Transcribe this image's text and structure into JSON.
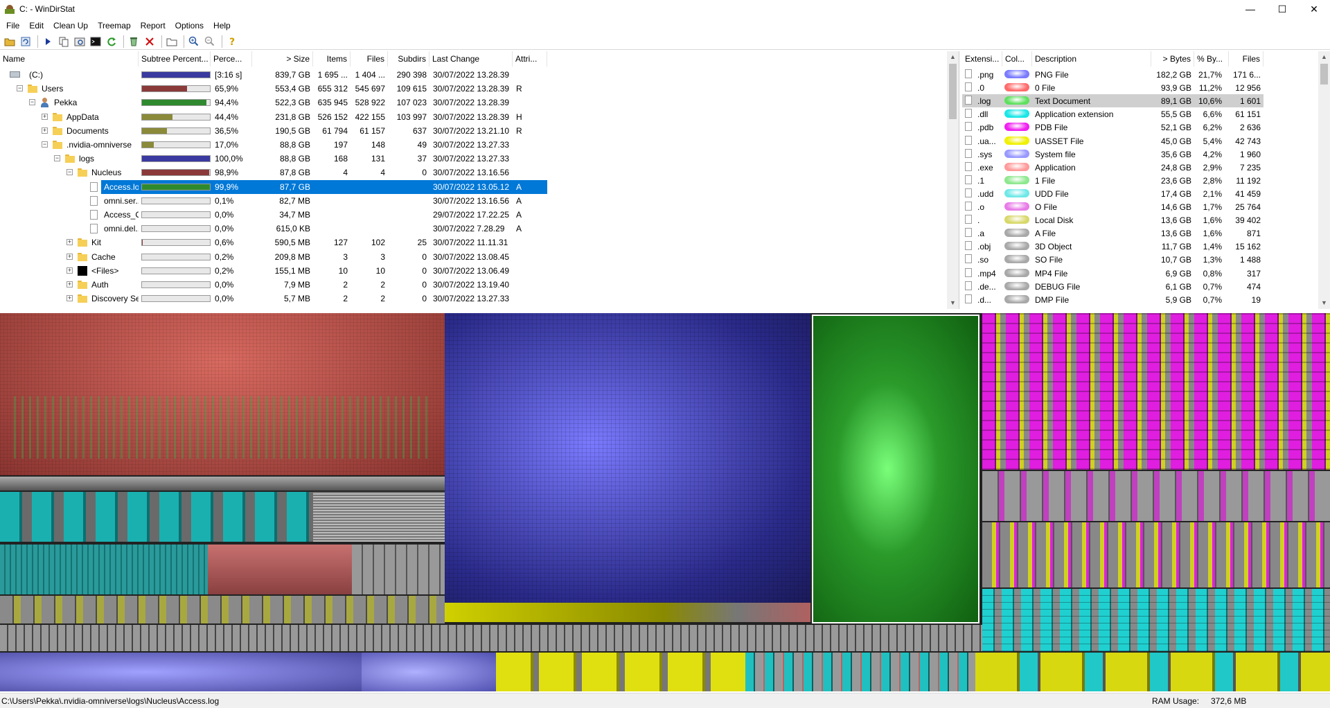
{
  "window": {
    "title": "C: - WinDirStat",
    "min": "—",
    "max": "☐",
    "close": "✕"
  },
  "menu": [
    "File",
    "Edit",
    "Clean Up",
    "Treemap",
    "Report",
    "Options",
    "Help"
  ],
  "toolbar_icons": [
    "open-icon",
    "refresh-all-icon",
    "play-icon",
    "copy-path-icon",
    "explorer-icon",
    "command-prompt-icon",
    "refresh-icon",
    "recycle-icon",
    "delete-icon",
    "new-folder-icon",
    "zoom-in-icon",
    "zoom-out-icon",
    "help-icon"
  ],
  "tree": {
    "columns": [
      "Name",
      "Subtree Percent...",
      "Perce...",
      "> Size",
      "Items",
      "Files",
      "Subdirs",
      "Last Change",
      "Attri..."
    ],
    "rows": [
      {
        "name": "(C:)",
        "icon": "drive",
        "indent": 0,
        "exp": "",
        "bar": 1.0,
        "bar_color": "#3a3aa0",
        "pct": "[3:16 s]",
        "size": "839,7 GB",
        "items": "1 695 ...",
        "files": "1 404 ...",
        "subdirs": "290 398",
        "changed": "30/07/2022  13.28.39",
        "attr": ""
      },
      {
        "name": "Users",
        "icon": "folder",
        "indent": 1,
        "exp": "−",
        "bar": 0.659,
        "bar_color": "#8b3a3a",
        "pct": "65,9%",
        "size": "553,4 GB",
        "items": "655 312",
        "files": "545 697",
        "subdirs": "109 615",
        "changed": "30/07/2022  13.28.39",
        "attr": "R"
      },
      {
        "name": "Pekka",
        "icon": "user",
        "indent": 2,
        "exp": "−",
        "bar": 0.944,
        "bar_color": "#2f8a2f",
        "pct": "94,4%",
        "size": "522,3 GB",
        "items": "635 945",
        "files": "528 922",
        "subdirs": "107 023",
        "changed": "30/07/2022  13.28.39",
        "attr": ""
      },
      {
        "name": "AppData",
        "icon": "folder",
        "indent": 3,
        "exp": "+",
        "bar": 0.444,
        "bar_color": "#8a8a3a",
        "pct": "44,4%",
        "size": "231,8 GB",
        "items": "526 152",
        "files": "422 155",
        "subdirs": "103 997",
        "changed": "30/07/2022  13.28.39",
        "attr": "H"
      },
      {
        "name": "Documents",
        "icon": "docs",
        "indent": 3,
        "exp": "+",
        "bar": 0.365,
        "bar_color": "#8a8a3a",
        "pct": "36,5%",
        "size": "190,5 GB",
        "items": "61 794",
        "files": "61 157",
        "subdirs": "637",
        "changed": "30/07/2022  13.21.10",
        "attr": "R"
      },
      {
        "name": ".nvidia-omniverse",
        "icon": "folder",
        "indent": 3,
        "exp": "−",
        "bar": 0.17,
        "bar_color": "#8a8a3a",
        "pct": "17,0%",
        "size": "88,8 GB",
        "items": "197",
        "files": "148",
        "subdirs": "49",
        "changed": "30/07/2022  13.27.33",
        "attr": ""
      },
      {
        "name": "logs",
        "icon": "folder",
        "indent": 4,
        "exp": "−",
        "bar": 1.0,
        "bar_color": "#3a3aa0",
        "pct": "100,0%",
        "size": "88,8 GB",
        "items": "168",
        "files": "131",
        "subdirs": "37",
        "changed": "30/07/2022  13.27.33",
        "attr": ""
      },
      {
        "name": "Nucleus",
        "icon": "folder",
        "indent": 5,
        "exp": "−",
        "bar": 0.989,
        "bar_color": "#8b3a3a",
        "pct": "98,9%",
        "size": "87,8 GB",
        "items": "4",
        "files": "4",
        "subdirs": "0",
        "changed": "30/07/2022  13.16.56",
        "attr": ""
      },
      {
        "name": "Access.log",
        "icon": "file",
        "indent": 6,
        "exp": "",
        "bar": 0.999,
        "bar_color": "#2f8a2f",
        "pct": "99,9%",
        "size": "87,7 GB",
        "items": "",
        "files": "",
        "subdirs": "",
        "changed": "30/07/2022  13.05.12",
        "attr": "A",
        "selected": true
      },
      {
        "name": "omni.ser...",
        "icon": "file",
        "indent": 6,
        "exp": "",
        "bar": 0.001,
        "bar_color": "#8a8a3a",
        "pct": "0,1%",
        "size": "82,7 MB",
        "items": "",
        "files": "",
        "subdirs": "",
        "changed": "30/07/2022  13.16.56",
        "attr": "A"
      },
      {
        "name": "Access_O...",
        "icon": "file",
        "indent": 6,
        "exp": "",
        "bar": 0.0,
        "bar_color": "#8a8a3a",
        "pct": "0,0%",
        "size": "34,7 MB",
        "items": "",
        "files": "",
        "subdirs": "",
        "changed": "29/07/2022  17.22.25",
        "attr": "A"
      },
      {
        "name": "omni.del...",
        "icon": "file",
        "indent": 6,
        "exp": "",
        "bar": 0.0,
        "bar_color": "#8a8a3a",
        "pct": "0,0%",
        "size": "615,0 KB",
        "items": "",
        "files": "",
        "subdirs": "",
        "changed": "30/07/2022  7.28.29",
        "attr": "A"
      },
      {
        "name": "Kit",
        "icon": "folder",
        "indent": 5,
        "exp": "+",
        "bar": 0.006,
        "bar_color": "#8b3a3a",
        "pct": "0,6%",
        "size": "590,5 MB",
        "items": "127",
        "files": "102",
        "subdirs": "25",
        "changed": "30/07/2022  11.11.31",
        "attr": ""
      },
      {
        "name": "Cache",
        "icon": "folder",
        "indent": 5,
        "exp": "+",
        "bar": 0.002,
        "bar_color": "#8b3a3a",
        "pct": "0,2%",
        "size": "209,8 MB",
        "items": "3",
        "files": "3",
        "subdirs": "0",
        "changed": "30/07/2022  13.08.45",
        "attr": ""
      },
      {
        "name": "<Files>",
        "icon": "black",
        "indent": 5,
        "exp": "+",
        "bar": 0.002,
        "bar_color": "#8b3a3a",
        "pct": "0,2%",
        "size": "155,1 MB",
        "items": "10",
        "files": "10",
        "subdirs": "0",
        "changed": "30/07/2022  13.06.49",
        "attr": ""
      },
      {
        "name": "Auth",
        "icon": "folder",
        "indent": 5,
        "exp": "+",
        "bar": 0.0,
        "bar_color": "#8b3a3a",
        "pct": "0,0%",
        "size": "7,9 MB",
        "items": "2",
        "files": "2",
        "subdirs": "0",
        "changed": "30/07/2022  13.19.40",
        "attr": ""
      },
      {
        "name": "Discovery Se...",
        "icon": "folder",
        "indent": 5,
        "exp": "+",
        "bar": 0.0,
        "bar_color": "#8b3a3a",
        "pct": "0,0%",
        "size": "5,7 MB",
        "items": "2",
        "files": "2",
        "subdirs": "0",
        "changed": "30/07/2022  13.27.33",
        "attr": ""
      }
    ]
  },
  "extensions": {
    "columns": [
      "Extensi...",
      "Col...",
      "Description",
      "> Bytes",
      "% By...",
      "Files"
    ],
    "rows": [
      {
        "ext": ".png",
        "color": "#7a7aff",
        "desc": "PNG File",
        "bytes": "182,2 GB",
        "pct": "21,7%",
        "files": "171 6..."
      },
      {
        "ext": ".0",
        "color": "#ff6a6a",
        "desc": "0 File",
        "bytes": "93,9 GB",
        "pct": "11,2%",
        "files": "12 956"
      },
      {
        "ext": ".log",
        "color": "#5ee05e",
        "desc": "Text Document",
        "bytes": "89,1 GB",
        "pct": "10,6%",
        "files": "1 601",
        "selected": true
      },
      {
        "ext": ".dll",
        "color": "#19e6e6",
        "desc": "Application extension",
        "bytes": "55,5 GB",
        "pct": "6,6%",
        "files": "61 151"
      },
      {
        "ext": ".pdb",
        "color": "#f01ef0",
        "desc": "PDB File",
        "bytes": "52,1 GB",
        "pct": "6,2%",
        "files": "2 636"
      },
      {
        "ext": ".ua...",
        "color": "#f0f000",
        "desc": "UASSET File",
        "bytes": "45,0 GB",
        "pct": "5,4%",
        "files": "42 743"
      },
      {
        "ext": ".sys",
        "color": "#9898ff",
        "desc": "System file",
        "bytes": "35,6 GB",
        "pct": "4,2%",
        "files": "1 960"
      },
      {
        "ext": ".exe",
        "color": "#ff9a9a",
        "desc": "Application",
        "bytes": "24,8 GB",
        "pct": "2,9%",
        "files": "7 235"
      },
      {
        "ext": ".1",
        "color": "#8de88d",
        "desc": "1 File",
        "bytes": "23,6 GB",
        "pct": "2,8%",
        "files": "11 192"
      },
      {
        "ext": ".udd",
        "color": "#6ee8e8",
        "desc": "UDD File",
        "bytes": "17,4 GB",
        "pct": "2,1%",
        "files": "41 459"
      },
      {
        "ext": ".o",
        "color": "#e87ae8",
        "desc": "O File",
        "bytes": "14,6 GB",
        "pct": "1,7%",
        "files": "25 764"
      },
      {
        "ext": ".",
        "color": "#d8d86a",
        "desc": "Local Disk",
        "bytes": "13,6 GB",
        "pct": "1,6%",
        "files": "39 402"
      },
      {
        "ext": ".a",
        "color": "#a8a8a8",
        "desc": "A File",
        "bytes": "13,6 GB",
        "pct": "1,6%",
        "files": "871"
      },
      {
        "ext": ".obj",
        "color": "#a8a8a8",
        "desc": "3D Object",
        "bytes": "11,7 GB",
        "pct": "1,4%",
        "files": "15 162"
      },
      {
        "ext": ".so",
        "color": "#a8a8a8",
        "desc": "SO File",
        "bytes": "10,7 GB",
        "pct": "1,3%",
        "files": "1 488"
      },
      {
        "ext": ".mp4",
        "color": "#a8a8a8",
        "desc": "MP4 File",
        "bytes": "6,9 GB",
        "pct": "0,8%",
        "files": "317"
      },
      {
        "ext": ".de...",
        "color": "#a8a8a8",
        "desc": "DEBUG File",
        "bytes": "6,1 GB",
        "pct": "0,7%",
        "files": "474"
      },
      {
        "ext": ".d...",
        "color": "#a8a8a8",
        "desc": "DMP File",
        "bytes": "5,9 GB",
        "pct": "0,7%",
        "files": "19"
      }
    ]
  },
  "status": {
    "path": "C:\\Users\\Pekka\\.nvidia-omniverse\\logs\\Nucleus\\Access.log",
    "ram_label": "RAM Usage:",
    "ram_value": "372,6 MB"
  }
}
